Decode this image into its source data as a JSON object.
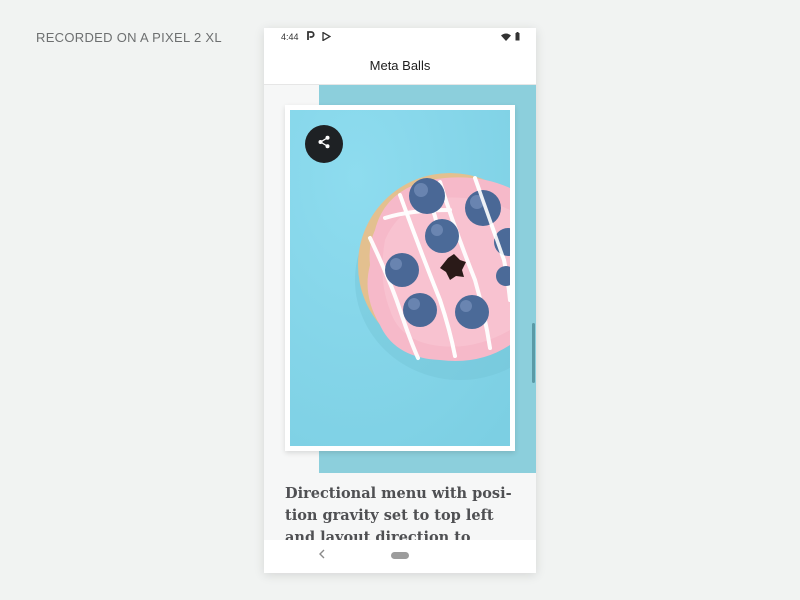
{
  "caption": "RECORDED ON A PIXEL 2 XL",
  "status_bar": {
    "time": "4:44",
    "notification_icons": [
      "p-icon",
      "play-store-icon"
    ],
    "system_icons": [
      "wifi-icon",
      "battery-icon"
    ]
  },
  "app_bar": {
    "title": "Meta Balls"
  },
  "card": {
    "image_subject": "donut-with-blueberries",
    "share_icon": "share-icon"
  },
  "headline": "Directional menu with posi-tion gravity set to top left and layout direction to vertical",
  "nav_bar": {
    "back_icon": "back-chevron-icon",
    "home_icon": "home-pill-icon"
  },
  "colors": {
    "background": "#f1f3f2",
    "teal_panel": "#8ccfdc",
    "image_bg": "#86d4e7",
    "share_button": "#1e2124",
    "headline_text": "#4f5053"
  }
}
